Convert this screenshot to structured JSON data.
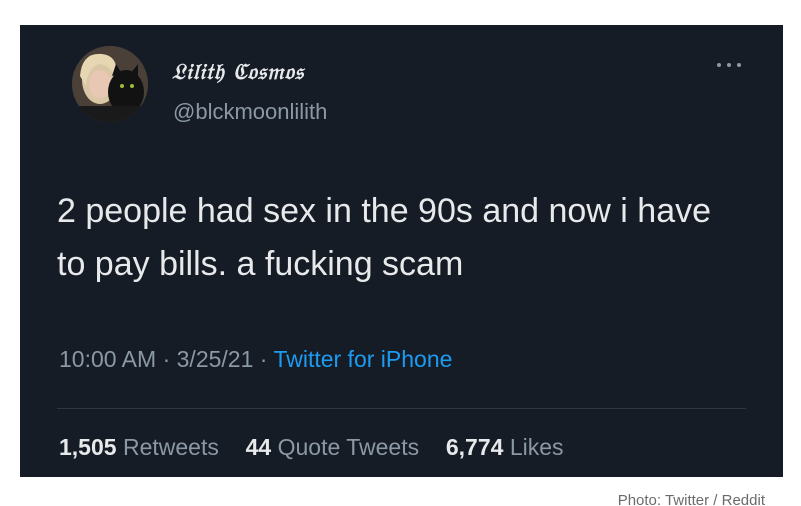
{
  "tweet": {
    "display_name": "𝔏𝔦𝔩𝔦𝔱𝔥 ℭ𝔬𝔰𝔪𝔬𝔰",
    "handle": "@blckmoonlilith",
    "text": "2 people had sex in the 90s and now i have to pay bills. a fucking scam",
    "time": "10:00 AM",
    "date": "3/25/21",
    "source": "Twitter for iPhone",
    "separator": "·",
    "retweets_count": "1,505",
    "retweets_label": "Retweets",
    "quotes_count": "44",
    "quotes_label": "Quote Tweets",
    "likes_count": "6,774",
    "likes_label": "Likes",
    "more_icon": "more-horizontal-icon",
    "avatar_icon": "user-avatar-photo"
  },
  "caption": {
    "credit": "Photo: Twitter / Reddit"
  },
  "colors": {
    "card_bg": "#151c26",
    "text_primary": "#e7e9ea",
    "text_secondary": "#8b98a5",
    "link": "#1d9bf0"
  }
}
